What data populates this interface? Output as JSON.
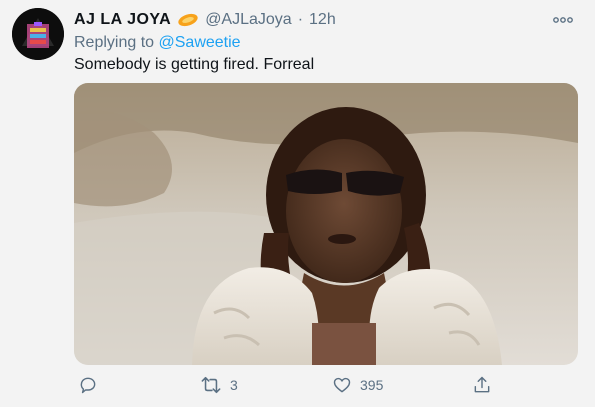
{
  "tweet": {
    "display_name": "AJ LA JOYA",
    "handle": "@AJLaJoya",
    "separator": "·",
    "time": "12h",
    "replying_prefix": "Replying to ",
    "replying_to": "@Saweetie",
    "text": "Somebody is getting fired. Forreal"
  },
  "actions": {
    "reply_count": "",
    "retweet_count": "3",
    "like_count": "395"
  },
  "colors": {
    "accent": "#1da1f2",
    "secondary_text": "#5b7083",
    "primary_text": "#0f1419"
  },
  "icons": {
    "verified": "orange-badge-icon",
    "more": "more-dots-icon",
    "reply": "reply-bubble-icon",
    "retweet": "retweet-icon",
    "like": "heart-icon",
    "share": "share-icon"
  }
}
